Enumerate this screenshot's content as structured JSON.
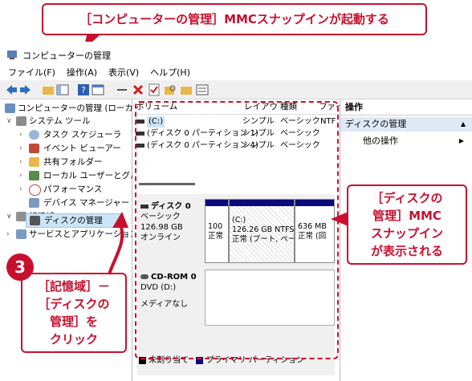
{
  "banner": {
    "text": "［コンピューターの管理］MMCスナップインが起動する"
  },
  "window": {
    "title": "コンピューターの管理"
  },
  "menu": [
    "ファイル(F)",
    "操作(A)",
    "表示(V)",
    "ヘルプ(H)"
  ],
  "tree": {
    "items": [
      {
        "label": "コンピューターの管理 (ローカル)",
        "icon": "computer-icon"
      },
      {
        "label": "システム ツール",
        "icon": "tools-icon"
      },
      {
        "label": "タスク スケジューラ",
        "icon": "clock-icon"
      },
      {
        "label": "イベント ビューアー",
        "icon": "event-icon"
      },
      {
        "label": "共有フォルダー",
        "icon": "folder-icon"
      },
      {
        "label": "ローカル ユーザーとグループ",
        "icon": "users-icon"
      },
      {
        "label": "パフォーマンス",
        "icon": "performance-icon"
      },
      {
        "label": "デバイス マネージャー",
        "icon": "device-icon"
      },
      {
        "label": "記憶域",
        "icon": "storage-icon"
      },
      {
        "label": "ディスクの管理",
        "icon": "disk-icon"
      },
      {
        "label": "サービスとアプリケーション",
        "icon": "services-icon"
      }
    ]
  },
  "volume_list": {
    "headers": [
      "ボリューム",
      "レイアウト",
      "種類",
      "ファイ"
    ],
    "rows": [
      {
        "volume": "(C:)",
        "layout": "シンプル",
        "type": "ベーシック",
        "fs": "NTF"
      },
      {
        "volume": "(ディスク 0 パーティション 1)",
        "layout": "シンプル",
        "type": "ベーシック",
        "fs": ""
      },
      {
        "volume": "(ディスク 0 パーティション 4)",
        "layout": "シンプル",
        "type": "ベーシック",
        "fs": ""
      }
    ]
  },
  "disks": [
    {
      "name": "ディスク 0",
      "kind": "ベーシック",
      "size": "126.98 GB",
      "status": "オンライン"
    },
    {
      "name": "CD-ROM 0",
      "kind": "DVD (D:)",
      "size": "",
      "status": "メディアなし"
    }
  ],
  "partitions": [
    {
      "line1": "100",
      "line2": "正常"
    },
    {
      "line1": "(C:)",
      "line2": "126.26 GB NTFS",
      "line3": "正常 (ブート, ペー"
    },
    {
      "line1": "636 MB",
      "line2": "正常 (回"
    }
  ],
  "legend": {
    "unallocated": "未割り当て",
    "primary": "プライマリ パーティション"
  },
  "actions": {
    "header": "操作",
    "section": "ディスクの管理",
    "item": "他の操作"
  },
  "callout_right": {
    "lines": [
      "［ディスクの",
      "管理］MMC",
      "スナップイン",
      "が表示される"
    ]
  },
  "callout_left": {
    "step": "3",
    "lines": [
      "［記憶域］－",
      "［ディスクの",
      "管理］を",
      "クリック"
    ]
  },
  "colors": {
    "accent": "#c8102e",
    "primary_partition": "#0a0a7a"
  }
}
